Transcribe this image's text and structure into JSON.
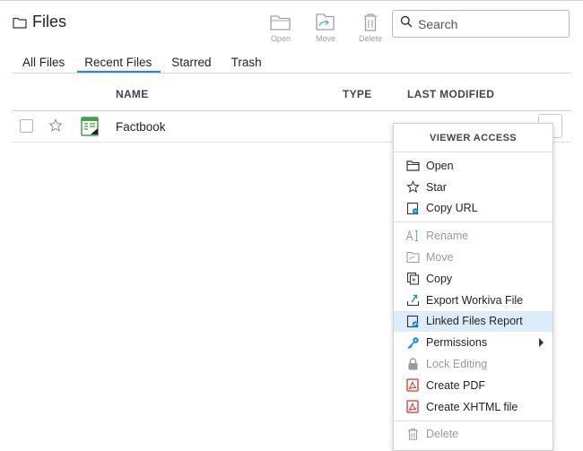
{
  "header": {
    "title": "Files"
  },
  "toolbar": {
    "open_label": "Open",
    "move_label": "Move",
    "delete_label": "Delete"
  },
  "search": {
    "placeholder": "Search"
  },
  "tabs": [
    {
      "label": "All Files"
    },
    {
      "label": "Recent Files"
    },
    {
      "label": "Starred"
    },
    {
      "label": "Trash"
    }
  ],
  "table": {
    "columns": {
      "name": "NAME",
      "type": "TYPE",
      "modified": "LAST MODIFIED"
    },
    "rows": [
      {
        "name": "Factbook"
      }
    ]
  },
  "menu": {
    "header": "VIEWER ACCESS",
    "items": [
      {
        "label": "Open",
        "icon": "folder-open-icon"
      },
      {
        "label": "Star",
        "icon": "star-icon"
      },
      {
        "label": "Copy URL",
        "icon": "copy-url-icon"
      },
      {
        "label": "Rename",
        "icon": "rename-icon"
      },
      {
        "label": "Move",
        "icon": "move-icon"
      },
      {
        "label": "Copy",
        "icon": "copy-icon"
      },
      {
        "label": "Export Workiva File",
        "icon": "export-icon"
      },
      {
        "label": "Linked Files Report",
        "icon": "linked-files-report-icon"
      },
      {
        "label": "Permissions",
        "icon": "permissions-key-icon"
      },
      {
        "label": "Lock Editing",
        "icon": "lock-icon"
      },
      {
        "label": "Create PDF",
        "icon": "pdf-icon"
      },
      {
        "label": "Create XHTML file",
        "icon": "xhtml-icon"
      },
      {
        "label": "Delete",
        "icon": "trash-icon"
      }
    ]
  },
  "colors": {
    "accent": "#1a8fd1",
    "highlight": "#dcecfa",
    "disabled": "#9a9a9a",
    "pdf_red": "#d9322b",
    "green": "#43a047"
  }
}
